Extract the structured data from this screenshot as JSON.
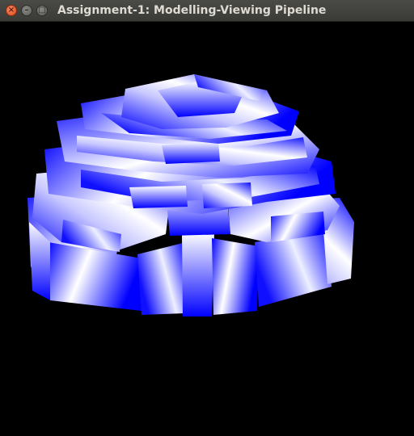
{
  "window": {
    "title": "Assignment-1: Modelling-Viewing Pipeline",
    "close_glyph": "×",
    "minimize_glyph": "–",
    "maximize_glyph": "□"
  },
  "render": {
    "background": "#000000",
    "primary_color": "#0000ff",
    "highlight_color": "#ffffff",
    "object": "stepped-dome-of-blue-prisms"
  }
}
